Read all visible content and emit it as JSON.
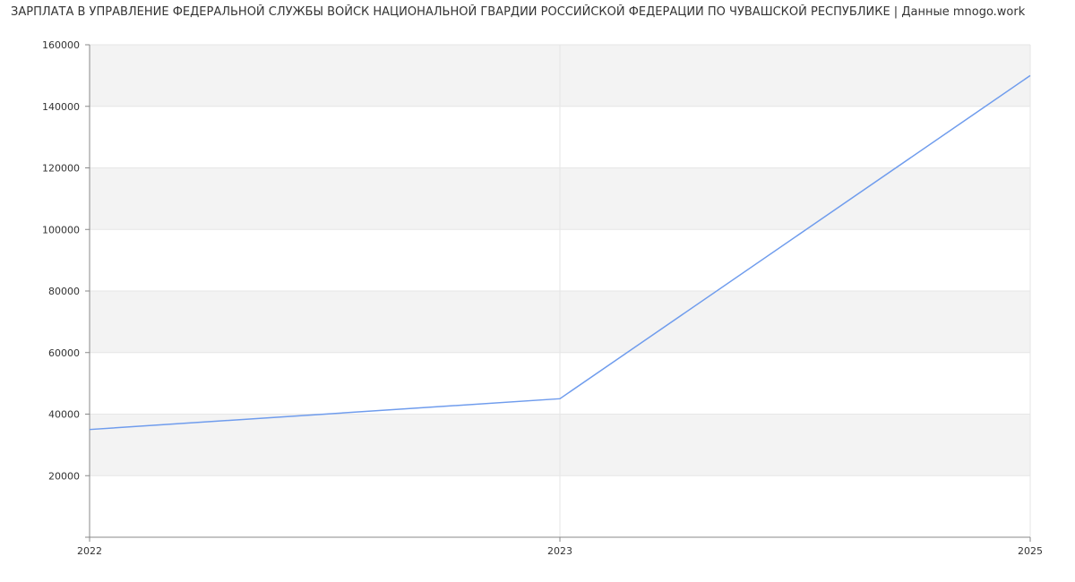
{
  "chart_data": {
    "type": "line",
    "title": "ЗАРПЛАТА В УПРАВЛЕНИЕ ФЕДЕРАЛЬНОЙ СЛУЖБЫ ВОЙСК НАЦИОНАЛЬНОЙ ГВАРДИИ РОССИЙСКОЙ ФЕДЕРАЦИИ ПО ЧУВАШСКОЙ РЕСПУБЛИКЕ | Данные mnogo.work",
    "xlabel": "",
    "ylabel": "",
    "x": [
      "2022",
      "2023",
      "2025"
    ],
    "series": [
      {
        "values": [
          35000,
          45000,
          150000
        ]
      }
    ],
    "ylim": [
      0,
      160000
    ],
    "yticks": [
      20000,
      40000,
      60000,
      80000,
      100000,
      120000,
      140000,
      160000
    ],
    "ytick_labels": [
      "20000",
      "40000",
      "60000",
      "80000",
      "100000",
      "120000",
      "140000",
      "160000"
    ],
    "grid": true,
    "alternating_bands": true,
    "line_color": "#6f9ced",
    "band_color": "#f3f3f3",
    "grid_color": "#e6e6e6",
    "axis_color": "#888888"
  }
}
